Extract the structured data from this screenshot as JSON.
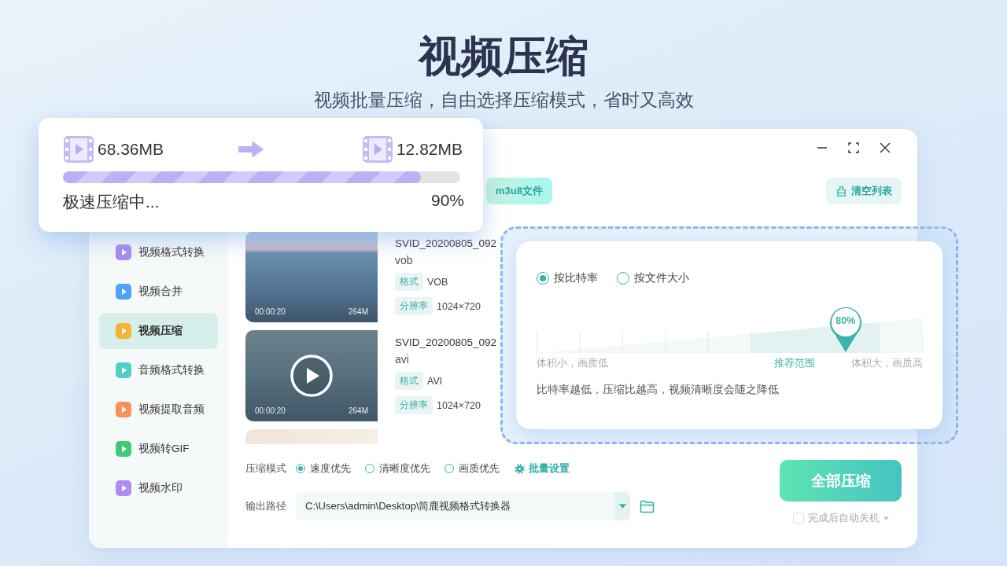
{
  "hero": {
    "title": "视频压缩",
    "subtitle": "视频批量压缩，自由选择压缩模式，省时又高效"
  },
  "progress_card": {
    "source_size": "68.36MB",
    "target_size": "12.82MB",
    "level": 0.9,
    "status": "极速压缩中...",
    "percent": "90%"
  },
  "toolbar": {
    "add_button": "m3u8文件",
    "clear_button": "清空列表"
  },
  "sidebar": {
    "items": [
      {
        "label": "视频格式转换",
        "selected": false,
        "color": "#a98af0"
      },
      {
        "label": "视频合并",
        "selected": false,
        "color": "#4da3f5"
      },
      {
        "label": "视频压缩",
        "selected": true,
        "color": "#f7b23b"
      },
      {
        "label": "音频格式转换",
        "selected": false,
        "color": "#4fd0c4"
      },
      {
        "label": "视频提取音频",
        "selected": false,
        "color": "#f7935a"
      },
      {
        "label": "视频转GIF",
        "selected": false,
        "color": "#43c87a"
      },
      {
        "label": "视频水印",
        "selected": false,
        "color": "#b08cf2"
      }
    ]
  },
  "videos": [
    {
      "name": "SVID_20200805_092",
      "ext": "vob",
      "format_label": "格式",
      "format": "VOB",
      "resolution_label": "分辨率",
      "resolution": "1024×720",
      "duration": "00:00:20",
      "size": "264M",
      "hovered": false
    },
    {
      "name": "SVID_20200805_092",
      "ext": "avi",
      "format_label": "格式",
      "format": "AVI",
      "resolution_label": "分辨率",
      "resolution": "1024×720",
      "duration": "00:00:20",
      "size": "264M",
      "hovered": true
    }
  ],
  "compress_mode": {
    "label": "压缩模式",
    "options": [
      {
        "label": "速度优先",
        "selected": true
      },
      {
        "label": "清晰度优先",
        "selected": false
      },
      {
        "label": "画质优先",
        "selected": false
      }
    ],
    "batch_link": "批量设置"
  },
  "output": {
    "label": "输出路径",
    "path": "C:\\Users\\admin\\Desktop\\简鹿视频格式转换器"
  },
  "start_button": "全部压缩",
  "shutdown": {
    "label": "完成后自动关机",
    "checked": false
  },
  "settings_popup": {
    "modes": [
      {
        "label": "按比特率",
        "selected": true
      },
      {
        "label": "按文件大小",
        "selected": false
      }
    ],
    "slider": {
      "level": 0.8,
      "reading": "80%",
      "min_label": "体积小，画质低",
      "recommended_label": "推荐范围",
      "max_label": "体积大，画质高"
    },
    "note": "比特率越低，压缩比越高，视频清晰度会随之降低"
  }
}
